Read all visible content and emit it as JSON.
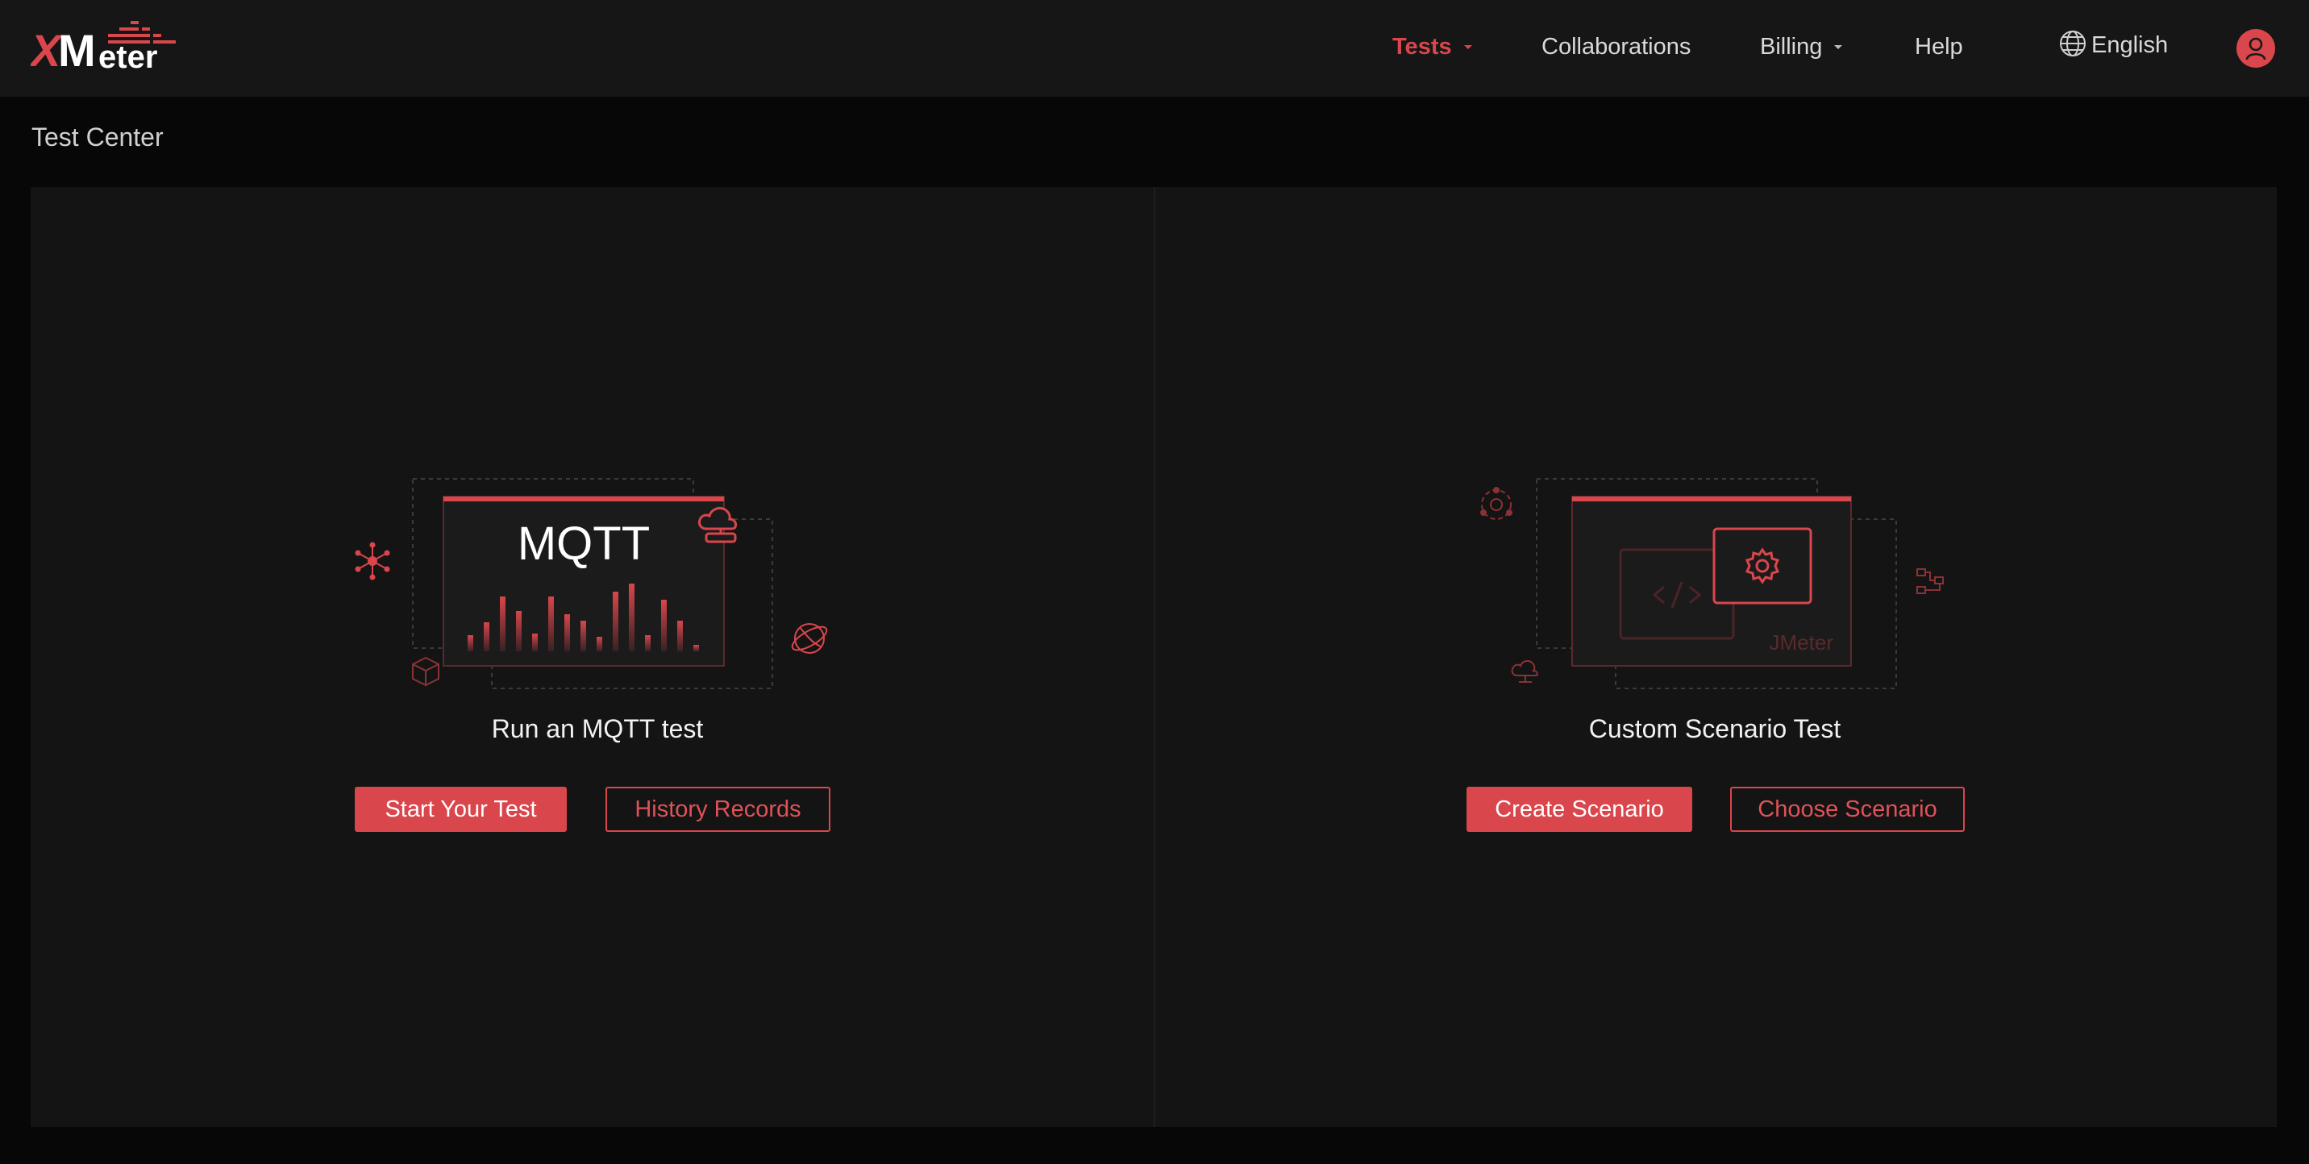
{
  "header": {
    "logo_text": "XMeter",
    "nav": [
      {
        "label": "Tests",
        "active": true,
        "has_dropdown": true
      },
      {
        "label": "Collaborations",
        "active": false,
        "has_dropdown": false
      },
      {
        "label": "Billing",
        "active": false,
        "has_dropdown": true
      },
      {
        "label": "Help",
        "active": false,
        "has_dropdown": false
      }
    ],
    "language": "English",
    "language_icon": "globe-icon",
    "user_icon": "user-avatar-icon"
  },
  "page": {
    "title": "Test Center"
  },
  "cards": [
    {
      "illustration_label": "MQTT",
      "title": "Run an MQTT test",
      "primary_button": "Start Your Test",
      "secondary_button": "History Records"
    },
    {
      "illustration_label": "JMeter",
      "title": "Custom Scenario Test",
      "primary_button": "Create Scenario",
      "secondary_button": "Choose Scenario"
    }
  ],
  "colors": {
    "accent": "#d9464c",
    "header_bg": "#161616",
    "page_bg": "#070707",
    "panel_bg": "#141414"
  }
}
